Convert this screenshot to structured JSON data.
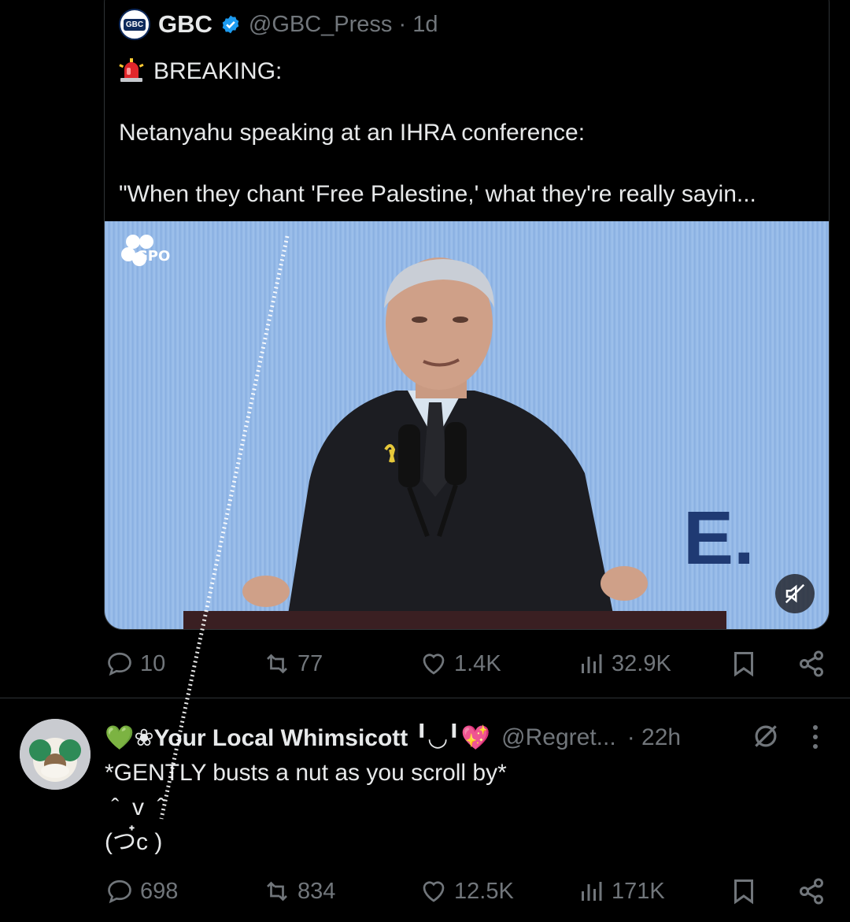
{
  "quote": {
    "author_logo_text": "GBC",
    "author_name": "GBC",
    "handle_time": "@GBC_Press · 1d",
    "body_breaking": "BREAKING:",
    "body_line2": "Netanyahu speaking at an IHRA conference:",
    "body_line3": "\"When they chant 'Free Palestine,' what they're really sayin...",
    "media": {
      "watermark": "GPO",
      "backdrop_letter": "E.",
      "mute_icon": "volume-muted-icon"
    }
  },
  "quote_actions": {
    "replies": "10",
    "reposts": "77",
    "likes": "1.4K",
    "views": "32.9K"
  },
  "reply": {
    "author_name": "💚❀Your Local Whimsicott ╹◡╹💖",
    "handle": "@Regret...",
    "time": "· 22h",
    "line1": "*GENTLY busts a nut as you scroll by*",
    "line2": " ˆ  v  ˆ",
    "line3": "(つ๋c )"
  },
  "reply_actions": {
    "replies": "698",
    "reposts": "834",
    "likes": "12.5K",
    "views": "171K"
  },
  "colors": {
    "background": "#000000",
    "text": "#e7e9ea",
    "muted": "#71767b",
    "border": "#2f3336",
    "accent": "#1d9bf0"
  }
}
